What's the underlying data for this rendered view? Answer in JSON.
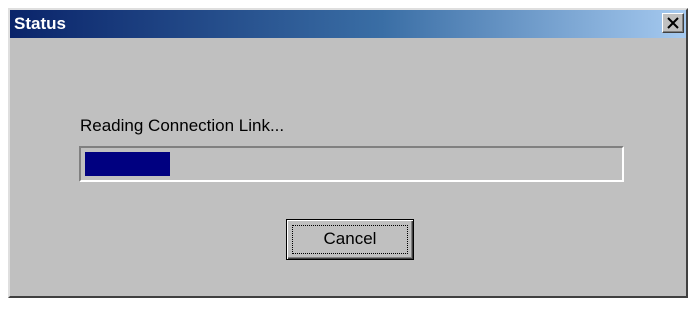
{
  "window": {
    "title": "Status"
  },
  "dialog": {
    "message": "Reading Connection Link...",
    "progress_fraction": 0.16,
    "cancel_label": "Cancel"
  },
  "icons": {
    "close": "close-icon"
  },
  "colors": {
    "title_bar_start": "#0a246a",
    "title_bar_end": "#a6caf0",
    "progress_fill": "#000080",
    "dialog_background": "#c0c0c0"
  }
}
